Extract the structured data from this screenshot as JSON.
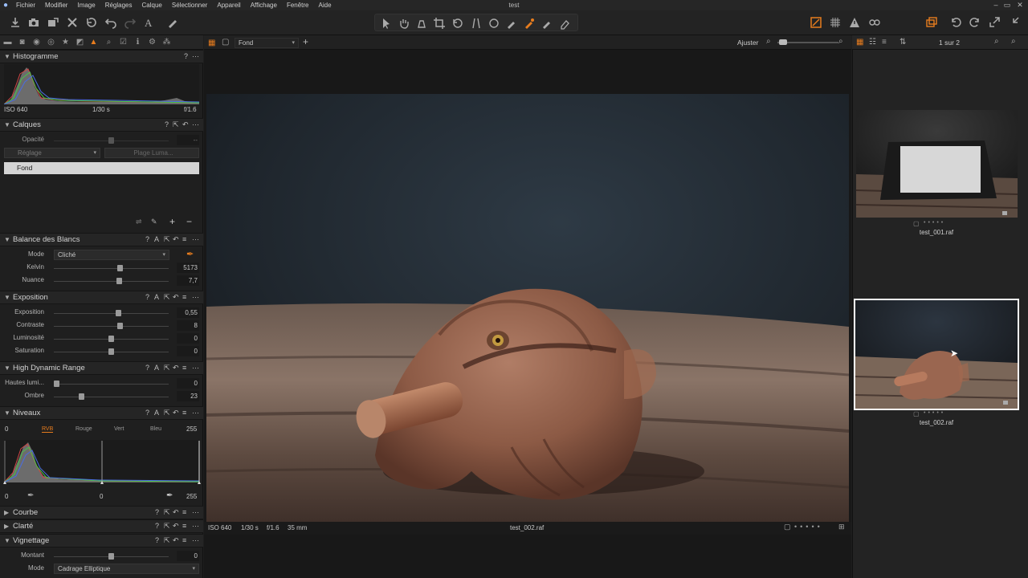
{
  "window": {
    "title": "test",
    "controls": [
      "–",
      "▭",
      "✕"
    ]
  },
  "menu": [
    "Fichier",
    "Modifier",
    "Image",
    "Réglages",
    "Calque",
    "Sélectionner",
    "Appareil",
    "Affichage",
    "Fenêtre",
    "Aide"
  ],
  "histogram": {
    "title": "Histogramme",
    "iso": "ISO 640",
    "shutter": "1/30 s",
    "aperture": "f/1.6"
  },
  "layers": {
    "title": "Calques",
    "opacity_label": "Opacité",
    "opacity_value": "--",
    "adjust_placeholder": "Réglage",
    "luma_placeholder": "Plage Luma...",
    "layer_name": "Fond"
  },
  "white_balance": {
    "title": "Balance des Blancs",
    "mode_label": "Mode",
    "mode_value": "Cliché",
    "kelvin_label": "Kelvin",
    "kelvin_value": "5173",
    "tint_label": "Nuance",
    "tint_value": "7,7"
  },
  "exposure": {
    "title": "Exposition",
    "rows": [
      {
        "label": "Exposition",
        "value": "0,55"
      },
      {
        "label": "Contraste",
        "value": "8"
      },
      {
        "label": "Luminosité",
        "value": "0"
      },
      {
        "label": "Saturation",
        "value": "0"
      }
    ]
  },
  "hdr": {
    "title": "High Dynamic Range",
    "rows": [
      {
        "label": "Hautes lumi...",
        "value": "0"
      },
      {
        "label": "Ombre",
        "value": "23"
      }
    ]
  },
  "levels": {
    "title": "Niveaux",
    "in_min": "0",
    "in_max": "255",
    "channels": [
      "RVB",
      "Rouge",
      "Vert",
      "Bleu"
    ],
    "out_min": "0",
    "mid": "0",
    "out_max": "255"
  },
  "collapsed": [
    {
      "title": "Courbe"
    },
    {
      "title": "Clarté"
    }
  ],
  "vignetting": {
    "title": "Vignettage",
    "amount_label": "Montant",
    "amount_value": "0",
    "mode_label": "Mode",
    "mode_value": "Cadrage Elliptique"
  },
  "viewer": {
    "layer_select": "Fond",
    "fit_label": "Ajuster",
    "info": {
      "iso": "ISO 640",
      "shutter": "1/30 s",
      "aperture": "f/1.6",
      "focal": "35 mm"
    },
    "filename": "test_002.raf"
  },
  "browser": {
    "counter": "1 sur 2",
    "items": [
      {
        "name": "test_001.raf",
        "selected": false
      },
      {
        "name": "test_002.raf",
        "selected": true
      }
    ]
  },
  "colors": {
    "accent": "#e87d1e",
    "panel": "#1f1f1f",
    "selection_border": "#ffffff"
  }
}
